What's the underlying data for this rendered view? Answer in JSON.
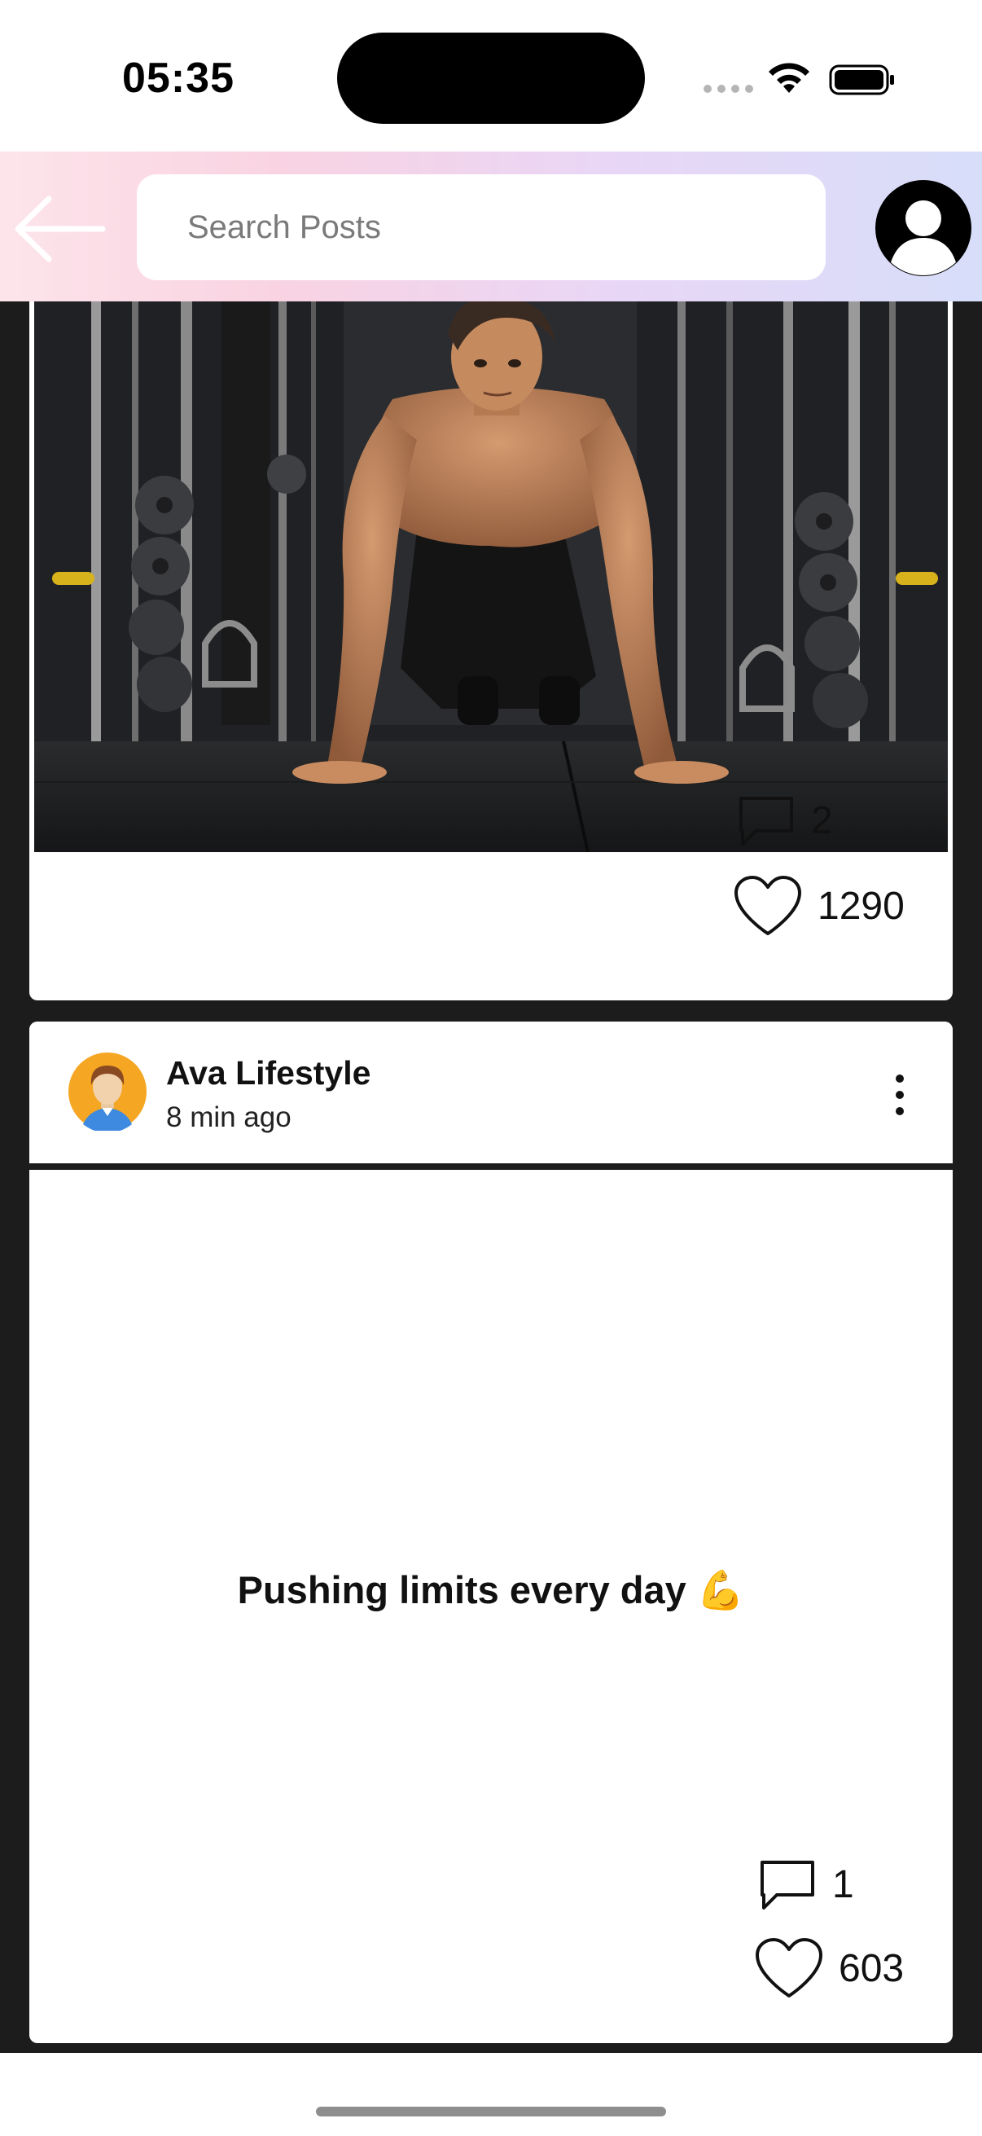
{
  "status_bar": {
    "time": "05:35"
  },
  "header": {
    "back_icon": "arrow-left-icon",
    "search_placeholder": "Search Posts",
    "profile_icon": "user-avatar-icon"
  },
  "posts": [
    {
      "image": "man doing push-up in gym",
      "comments": "2",
      "likes": "1290"
    },
    {
      "author": "Ava Lifestyle",
      "time": "8 min ago",
      "text": "Pushing limits every day 💪",
      "comments": "1",
      "likes": "603",
      "menu_icon": "more-vertical-icon"
    }
  ],
  "colors": {
    "header_gradient": [
      "#fde4ea",
      "#f9d3e2",
      "#e9d6f6",
      "#d7def9"
    ],
    "feed_background": "#1c1c1c",
    "card_background": "#ffffff"
  }
}
